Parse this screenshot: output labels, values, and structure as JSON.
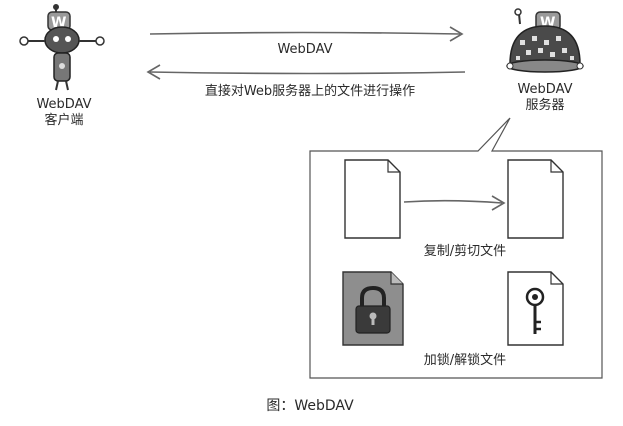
{
  "client": {
    "line1": "WebDAV",
    "line2": "客户端"
  },
  "server": {
    "line1": "WebDAV",
    "line2": "服务器"
  },
  "arrows": {
    "top_label": "WebDAV",
    "bottom_label": "直接对Web服务器上的文件进行操作"
  },
  "panel": {
    "copy_label": "复制/剪切文件",
    "lock_label": "加锁/解锁文件"
  },
  "caption": "图：WebDAV",
  "icons": {
    "client": "robot-client-icon",
    "server": "robot-server-icon",
    "doc": "document-icon",
    "lock": "padlock-icon",
    "key": "key-icon"
  }
}
